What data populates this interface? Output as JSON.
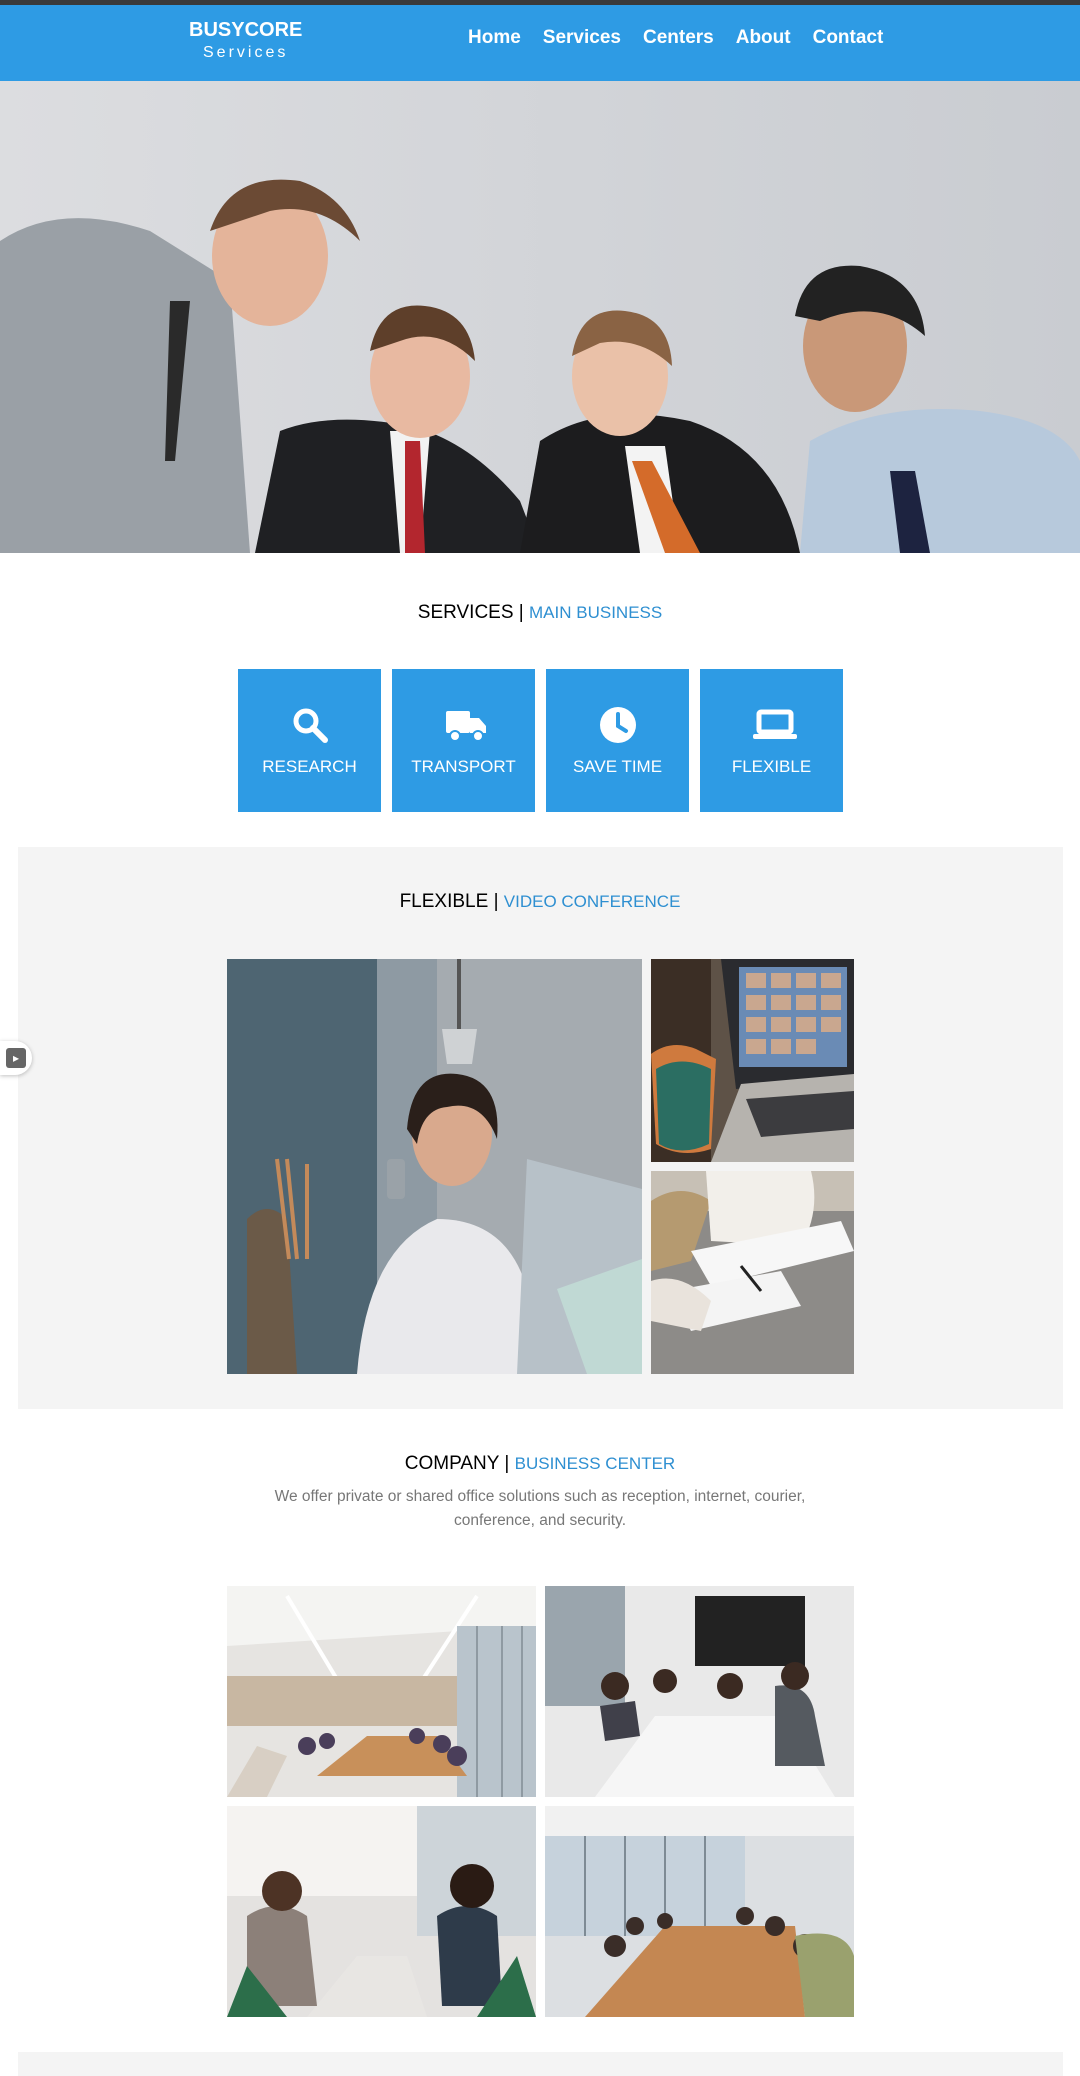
{
  "header": {
    "brand_name": "BUSYCORE",
    "brand_sub": "Services",
    "nav": [
      "Home",
      "Services",
      "Centers",
      "About",
      "Contact"
    ]
  },
  "services": {
    "title": "SERVICES",
    "sep": "|",
    "subtitle": "MAIN BUSINESS",
    "tiles": [
      {
        "label": "RESEARCH",
        "icon": "search-icon"
      },
      {
        "label": "TRANSPORT",
        "icon": "truck-icon"
      },
      {
        "label": "SAVE TIME",
        "icon": "clock-icon"
      },
      {
        "label": "FLEXIBLE",
        "icon": "laptop-icon"
      }
    ]
  },
  "flexible": {
    "title": "FLEXIBLE",
    "sep": "|",
    "subtitle": "VIDEO CONFERENCE"
  },
  "company": {
    "title": "COMPANY",
    "sep": "|",
    "subtitle": "BUSINESS CENTER",
    "description": "We offer private or shared office solutions such as reception, internet, courier, conference, and security."
  },
  "colors": {
    "primary": "#2e9be4",
    "accent_text": "#2e8fd1",
    "section_bg": "#f4f4f4"
  }
}
